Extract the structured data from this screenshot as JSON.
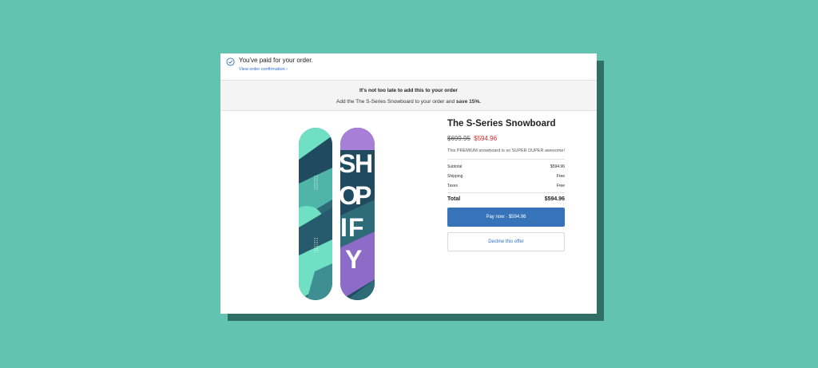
{
  "confirmation": {
    "title": "You've paid for your order.",
    "link_label": "View order confirmation ›"
  },
  "upsell": {
    "headline": "It's not too late to add this to your order",
    "sub_prefix": "Add the The S-Series Snowboard to your order and ",
    "sub_bold": "save 15%."
  },
  "product": {
    "title": "The S-Series Snowboard",
    "price_original": "$699.95",
    "price_sale": "$594.96",
    "description": "This PREMIUM snowboard is so SUPER DUPER awesome!",
    "image_icon": "snowboard-image",
    "board_text": "SHOPIFY"
  },
  "summary": {
    "subtotal_label": "Subtotal",
    "subtotal_value": "$594.96",
    "shipping_label": "Shipping",
    "shipping_value": "Free",
    "taxes_label": "Taxes",
    "taxes_value": "Free",
    "total_label": "Total",
    "total_value": "$594.96"
  },
  "actions": {
    "pay_label": "Pay now · $594.96",
    "decline_label": "Decline this offer"
  },
  "colors": {
    "background": "#62c3b1",
    "pay_button": "#3773b8",
    "sale_price": "#d62b2b",
    "link": "#2c6ecb"
  }
}
